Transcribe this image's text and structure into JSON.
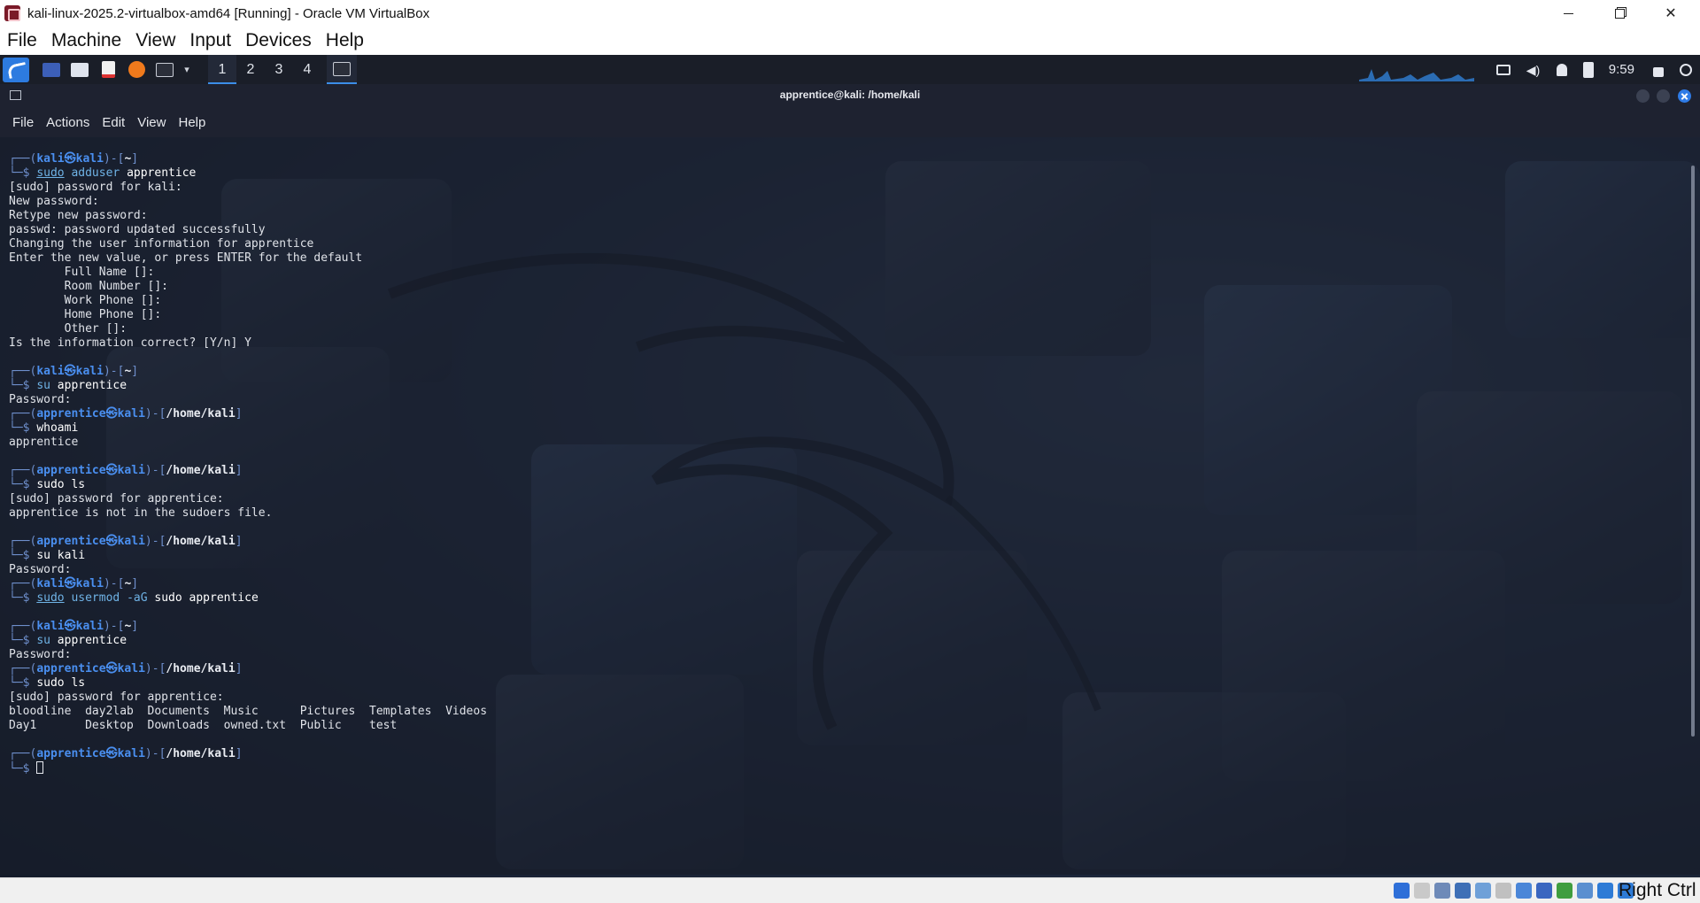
{
  "host": {
    "window_title": "kali-linux-2025.2-virtualbox-amd64 [Running] - Oracle VM VirtualBox",
    "close_glyph": "✕",
    "menu": [
      "File",
      "Machine",
      "View",
      "Input",
      "Devices",
      "Help"
    ],
    "status_icons": [
      "audio-icon",
      "optical-disk-icon",
      "usb-icon",
      "network-icon",
      "shared-folder-icon",
      "pen-icon",
      "floppy-icon",
      "display-icon",
      "recording-icon",
      "cpu-icon",
      "mouse-integration-icon",
      "keyboard-icon"
    ],
    "host_key_label": "Right Ctrl"
  },
  "panel": {
    "workspaces": [
      "1",
      "2",
      "3",
      "4"
    ],
    "active_workspace": "1",
    "clock": "9:59"
  },
  "terminal": {
    "title": "apprentice@kali: /home/kali",
    "menu": [
      "File",
      "Actions",
      "Edit",
      "View",
      "Help"
    ],
    "lines": [
      {
        "type": "prompt",
        "user": "kali",
        "host": "kali",
        "path": "~"
      },
      {
        "type": "cmd",
        "parts": [
          {
            "t": "sudo",
            "c": "cmd-ul"
          },
          {
            "t": " adduser",
            "c": "cmd-hl"
          },
          {
            "t": " apprentice",
            "c": "cmd"
          }
        ]
      },
      {
        "type": "out",
        "text": "[sudo] password for kali:"
      },
      {
        "type": "out",
        "text": "New password:"
      },
      {
        "type": "out",
        "text": "Retype new password:"
      },
      {
        "type": "out",
        "text": "passwd: password updated successfully"
      },
      {
        "type": "out",
        "text": "Changing the user information for apprentice"
      },
      {
        "type": "out",
        "text": "Enter the new value, or press ENTER for the default"
      },
      {
        "type": "out",
        "text": "        Full Name []:"
      },
      {
        "type": "out",
        "text": "        Room Number []:"
      },
      {
        "type": "out",
        "text": "        Work Phone []:"
      },
      {
        "type": "out",
        "text": "        Home Phone []:"
      },
      {
        "type": "out",
        "text": "        Other []:"
      },
      {
        "type": "out",
        "text": "Is the information correct? [Y/n] Y"
      },
      {
        "type": "blank"
      },
      {
        "type": "prompt",
        "user": "kali",
        "host": "kali",
        "path": "~"
      },
      {
        "type": "cmd",
        "parts": [
          {
            "t": "su",
            "c": "cmd-hl"
          },
          {
            "t": " apprentice",
            "c": "cmd"
          }
        ]
      },
      {
        "type": "out",
        "text": "Password:"
      },
      {
        "type": "prompt",
        "user": "apprentice",
        "host": "kali",
        "path": "/home/kali"
      },
      {
        "type": "cmd",
        "parts": [
          {
            "t": "whoami",
            "c": "cmd"
          }
        ]
      },
      {
        "type": "out",
        "text": "apprentice"
      },
      {
        "type": "blank"
      },
      {
        "type": "prompt",
        "user": "apprentice",
        "host": "kali",
        "path": "/home/kali"
      },
      {
        "type": "cmd",
        "parts": [
          {
            "t": "sudo ls",
            "c": "cmd"
          }
        ]
      },
      {
        "type": "out",
        "text": "[sudo] password for apprentice:"
      },
      {
        "type": "out",
        "text": "apprentice is not in the sudoers file."
      },
      {
        "type": "blank"
      },
      {
        "type": "prompt",
        "user": "apprentice",
        "host": "kali",
        "path": "/home/kali"
      },
      {
        "type": "cmd",
        "parts": [
          {
            "t": "su kali",
            "c": "cmd"
          }
        ]
      },
      {
        "type": "out",
        "text": "Password:"
      },
      {
        "type": "prompt",
        "user": "kali",
        "host": "kali",
        "path": "~"
      },
      {
        "type": "cmd",
        "parts": [
          {
            "t": "sudo",
            "c": "cmd-ul"
          },
          {
            "t": " usermod",
            "c": "cmd-hl"
          },
          {
            "t": " -aG",
            "c": "cmd-hl"
          },
          {
            "t": " sudo apprentice",
            "c": "cmd"
          }
        ]
      },
      {
        "type": "blank"
      },
      {
        "type": "prompt",
        "user": "kali",
        "host": "kali",
        "path": "~"
      },
      {
        "type": "cmd",
        "parts": [
          {
            "t": "su",
            "c": "cmd-hl"
          },
          {
            "t": " apprentice",
            "c": "cmd"
          }
        ]
      },
      {
        "type": "out",
        "text": "Password:"
      },
      {
        "type": "prompt",
        "user": "apprentice",
        "host": "kali",
        "path": "/home/kali"
      },
      {
        "type": "cmd",
        "parts": [
          {
            "t": "sudo ls",
            "c": "cmd"
          }
        ]
      },
      {
        "type": "out",
        "text": "[sudo] password for apprentice:"
      },
      {
        "type": "out",
        "text": "bloodline  day2lab  Documents  Music      Pictures  Templates  Videos"
      },
      {
        "type": "out",
        "text": "Day1       Desktop  Downloads  owned.txt  Public    test"
      },
      {
        "type": "blank"
      },
      {
        "type": "prompt",
        "user": "apprentice",
        "host": "kali",
        "path": "/home/kali"
      },
      {
        "type": "cursor"
      }
    ]
  }
}
